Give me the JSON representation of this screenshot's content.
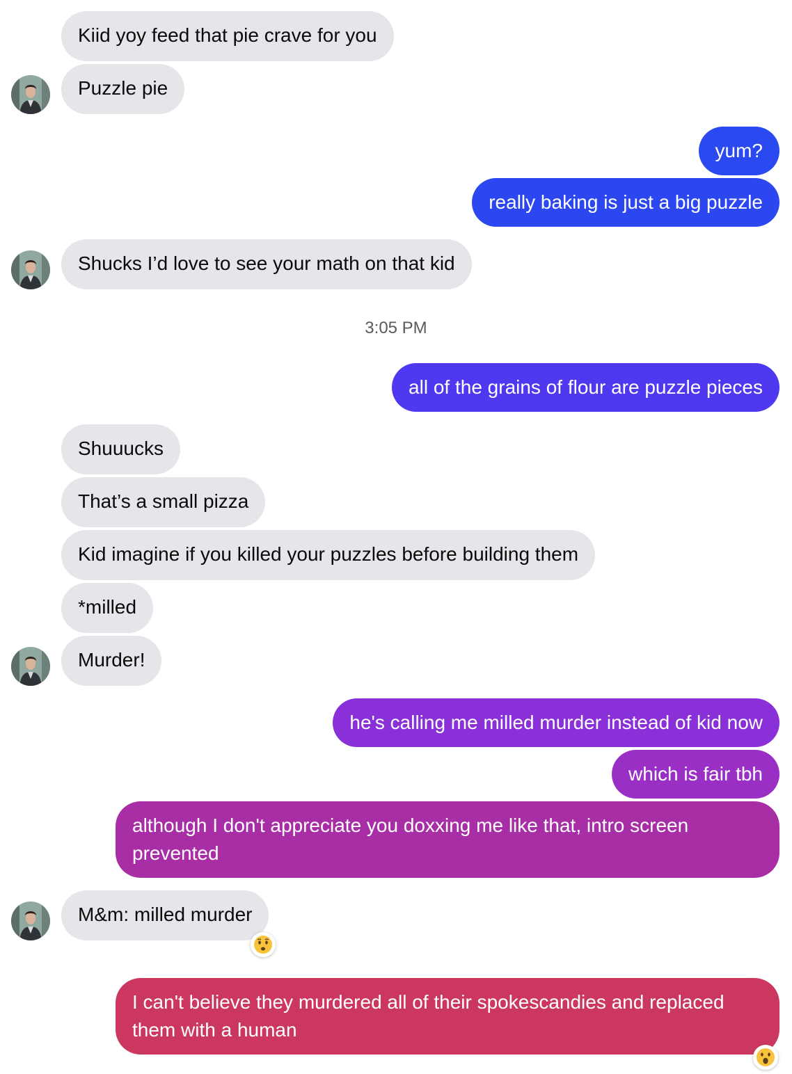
{
  "conversation": {
    "timestamp": "3:05 PM",
    "messages": [
      {
        "text": "Kiid yoy feed that pie crave for you"
      },
      {
        "text": "Puzzle pie"
      },
      {
        "text": "yum?"
      },
      {
        "text": "really baking is just a big puzzle"
      },
      {
        "text": "Shucks I’d love to see your math on that kid"
      },
      {
        "text": "all of the grains of flour are puzzle pieces"
      },
      {
        "text": "Shuuucks"
      },
      {
        "text": "That’s a small pizza"
      },
      {
        "text": "Kid imagine if you killed your puzzles before building them"
      },
      {
        "text": "*milled"
      },
      {
        "text": "Murder!"
      },
      {
        "text": "he's calling me milled murder instead of kid now"
      },
      {
        "text": "which is fair tbh"
      },
      {
        "text": "although I don't appreciate you doxxing me like that, intro screen prevented"
      },
      {
        "text": "M&m: milled murder"
      },
      {
        "text": "I can't believe they murdered all of their spokescandies and replaced them with a human"
      }
    ]
  },
  "colors": {
    "incoming_bubble": "#e5e6ea",
    "outgoing_blue": "#2a49f0",
    "outgoing_indigo": "#4e38f0",
    "outgoing_violet": "#8a30d8",
    "outgoing_purple": "#a82ea6",
    "outgoing_pink": "#cc3760"
  },
  "icons": {
    "avatar": "contact-avatar",
    "reaction_hushed": "hushed-face-emoji",
    "reaction_surprised": "surprised-face-emoji"
  }
}
